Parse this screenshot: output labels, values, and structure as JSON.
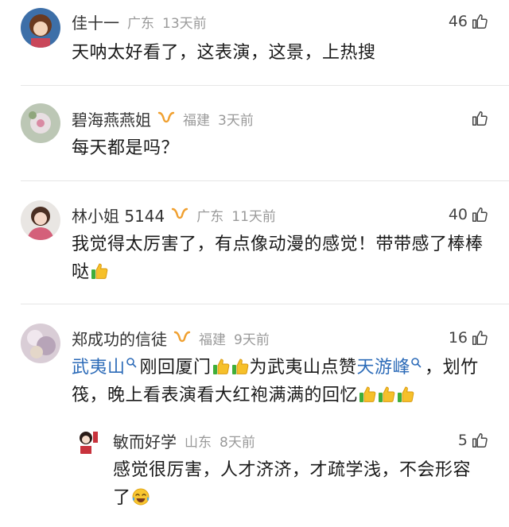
{
  "comments": [
    {
      "name": "佳十一",
      "location": "广东",
      "time": "13天前",
      "likes": "46",
      "text": "天呐太好看了，这表演，这景，上热搜"
    },
    {
      "name": "碧海燕燕姐",
      "location": "福建",
      "time": "3天前",
      "likes": "",
      "text": "每天都是吗？"
    },
    {
      "name": "林小姐 5144",
      "location": "广东",
      "time": "11天前",
      "likes": "40",
      "text": "我觉得太厉害了，有点像动漫的感觉！带带感了棒棒哒"
    },
    {
      "name": "郑成功的信徒",
      "location": "福建",
      "time": "9天前",
      "likes": "16",
      "topic1": "武夷山",
      "text_a": "刚回厦门",
      "text_b": "为武夷山点赞",
      "topic2": "天游峰",
      "text_c": "，划竹筏，晚上看表演看大红袍满满的回忆",
      "reply": {
        "name": "敏而好学",
        "location": "山东",
        "time": "8天前",
        "likes": "5",
        "text": "感觉很厉害，人才济济，才疏学浅，不会形容了"
      }
    }
  ],
  "icons": {
    "like": "thumbs-up-outline-icon",
    "vip": "vip-badge-icon",
    "emoji_thumb": "thumbs-up-emoji",
    "emoji_laugh": "tears-of-joy-emoji"
  },
  "colors": {
    "link": "#2c6bb8",
    "meta": "#9a9a9a",
    "vip": "#f0a030"
  }
}
